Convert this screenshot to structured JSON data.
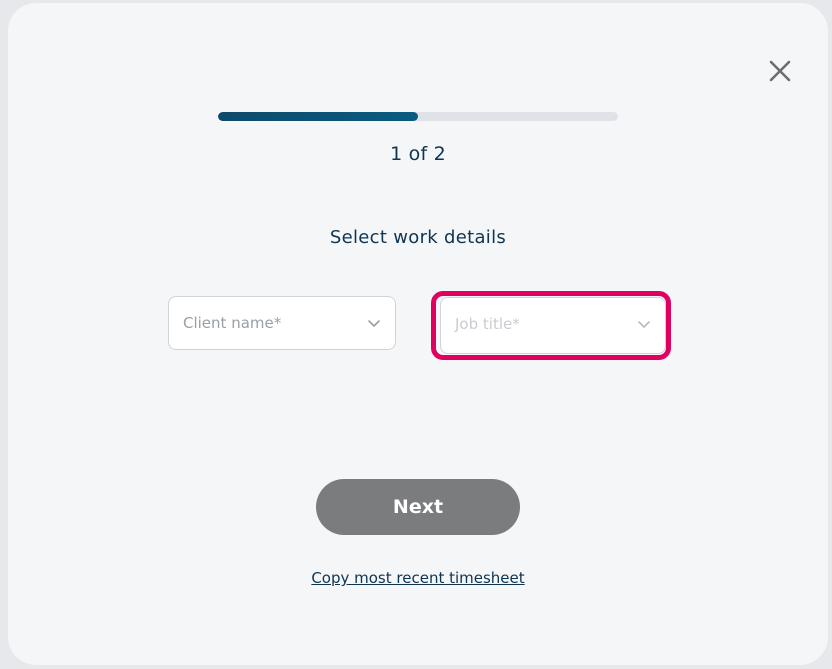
{
  "dialog": {
    "close_icon": "close-icon",
    "progress": {
      "fraction": 0.5,
      "label": "1 of 2"
    },
    "title": "Select work details",
    "fields": {
      "client_name": {
        "placeholder": "Client name*",
        "icon": "chevron-down-icon"
      },
      "job_title": {
        "placeholder": "Job title*",
        "icon": "chevron-down-icon"
      }
    },
    "next_label": "Next",
    "copy_link_label": "Copy most recent timesheet",
    "colors": {
      "progress_fill": "#0a5b82",
      "highlight": "#e0005f",
      "button": "#7b7c7e",
      "text": "#0e3450"
    }
  }
}
